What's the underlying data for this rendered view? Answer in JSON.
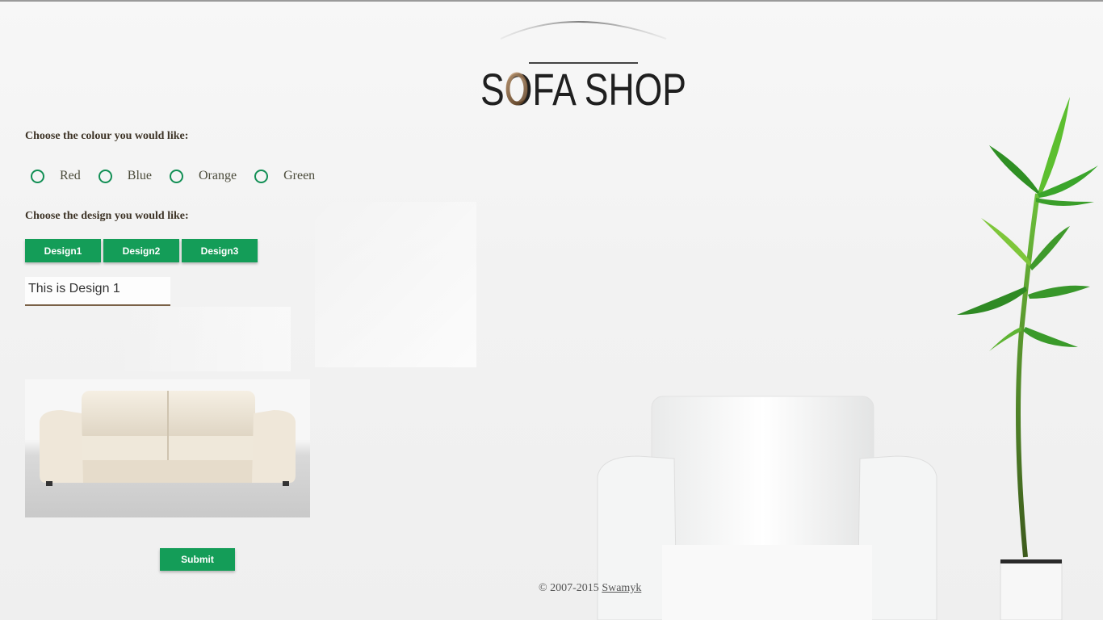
{
  "logo": {
    "text": "SOFA SHOP"
  },
  "colour_section": {
    "label": "Choose the colour you would like:",
    "options": [
      "Red",
      "Blue",
      "Orange",
      "Green"
    ],
    "accent_color": "#128f55"
  },
  "design_section": {
    "label": "Choose the design you would like:",
    "buttons": [
      "Design1",
      "Design2",
      "Design3"
    ],
    "field_value": "This is Design 1",
    "button_color": "#149d58"
  },
  "submit": {
    "label": "Submit"
  },
  "footer": {
    "copyright": "© 2007-2015",
    "link": "Swamyk"
  }
}
